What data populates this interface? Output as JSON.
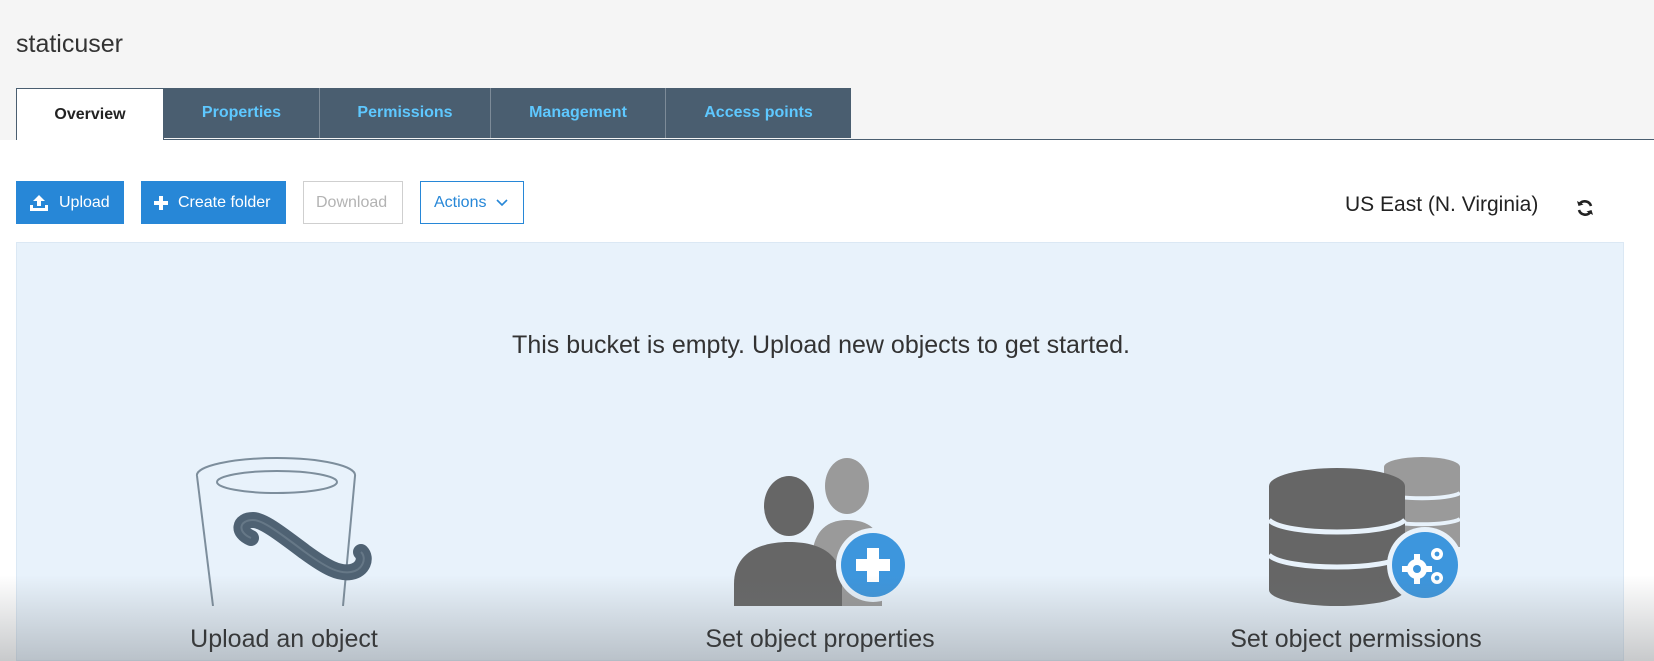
{
  "bucket": {
    "name": "staticuser"
  },
  "tabs": [
    {
      "label": "Overview",
      "active": true
    },
    {
      "label": "Properties"
    },
    {
      "label": "Permissions"
    },
    {
      "label": "Management"
    },
    {
      "label": "Access points"
    }
  ],
  "toolbar": {
    "upload_label": "Upload",
    "create_folder_label": "Create folder",
    "download_label": "Download",
    "actions_label": "Actions"
  },
  "region": {
    "label": "US East (N. Virginia)"
  },
  "empty_state": {
    "message": "This bucket is empty. Upload new objects to get started.",
    "cards": [
      {
        "label": "Upload an object",
        "icon": "bucket-icon"
      },
      {
        "label": "Set object properties",
        "icon": "users-add-icon"
      },
      {
        "label": "Set object permissions",
        "icon": "database-gear-icon"
      }
    ]
  },
  "colors": {
    "tab_bg": "#4a5e70",
    "tab_text": "#5ec8ff",
    "primary": "#2787d7",
    "panel_bg": "#e8f2fb",
    "badge_blue": "#3d96dd"
  }
}
